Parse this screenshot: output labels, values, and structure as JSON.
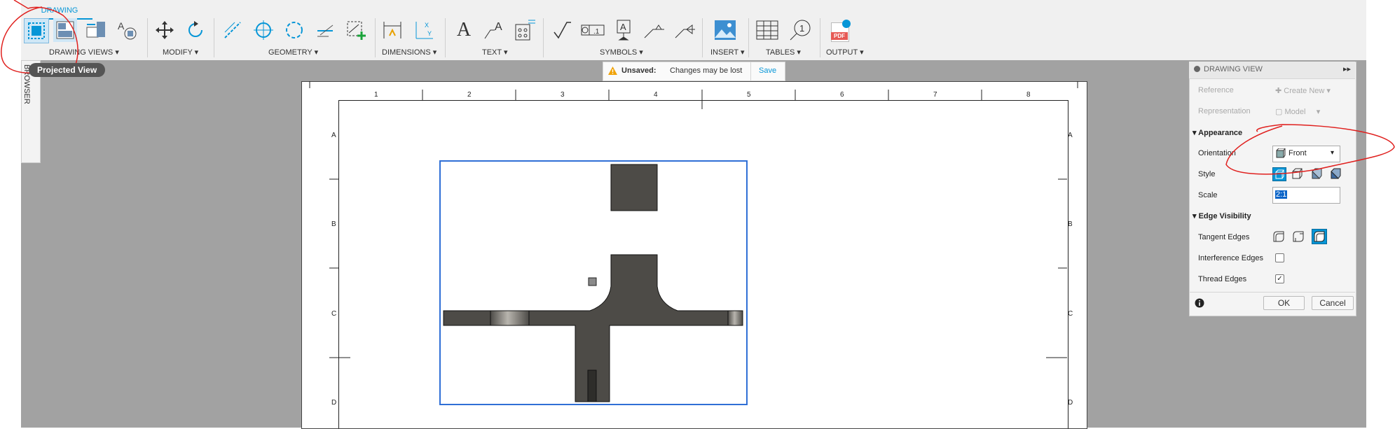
{
  "toolbar": {
    "tab": "DRAWING",
    "groups": {
      "drawing_views": "DRAWING VIEWS ▾",
      "modify": "MODIFY ▾",
      "geometry": "GEOMETRY ▾",
      "dimensions": "DIMENSIONS ▾",
      "text": "TEXT ▾",
      "symbols": "SYMBOLS ▾",
      "insert": "INSERT ▾",
      "tables": "TABLES ▾",
      "output": "OUTPUT ▾"
    },
    "tooltip": "Projected View",
    "pdf_label": "PDF",
    "text_glyph": "A",
    "balloon_number": "1"
  },
  "browser": {
    "label": "BROWSER"
  },
  "unsaved": {
    "label": "Unsaved:",
    "message": "Changes may be lost",
    "save": "Save"
  },
  "sheet": {
    "columns": [
      "1",
      "2",
      "3",
      "4",
      "5",
      "6",
      "7",
      "8"
    ],
    "rows": [
      "A",
      "B",
      "C",
      "D"
    ]
  },
  "panel": {
    "title": "DRAWING VIEW",
    "reference_label": "Reference",
    "reference_value": "Create New",
    "representation_label": "Representation",
    "representation_value": "Model",
    "appearance_section": "Appearance",
    "orientation_label": "Orientation",
    "orientation_value": "Front",
    "style_label": "Style",
    "scale_label": "Scale",
    "scale_value": "2:1",
    "edge_section": "Edge Visibility",
    "tangent_label": "Tangent Edges",
    "interference_label": "Interference Edges",
    "thread_label": "Thread Edges",
    "ok": "OK",
    "cancel": "Cancel"
  },
  "colors": {
    "accent": "#0696d7",
    "annotation": "#e0201e",
    "part": "#4d4b47",
    "view_border": "#2f6fd6"
  }
}
